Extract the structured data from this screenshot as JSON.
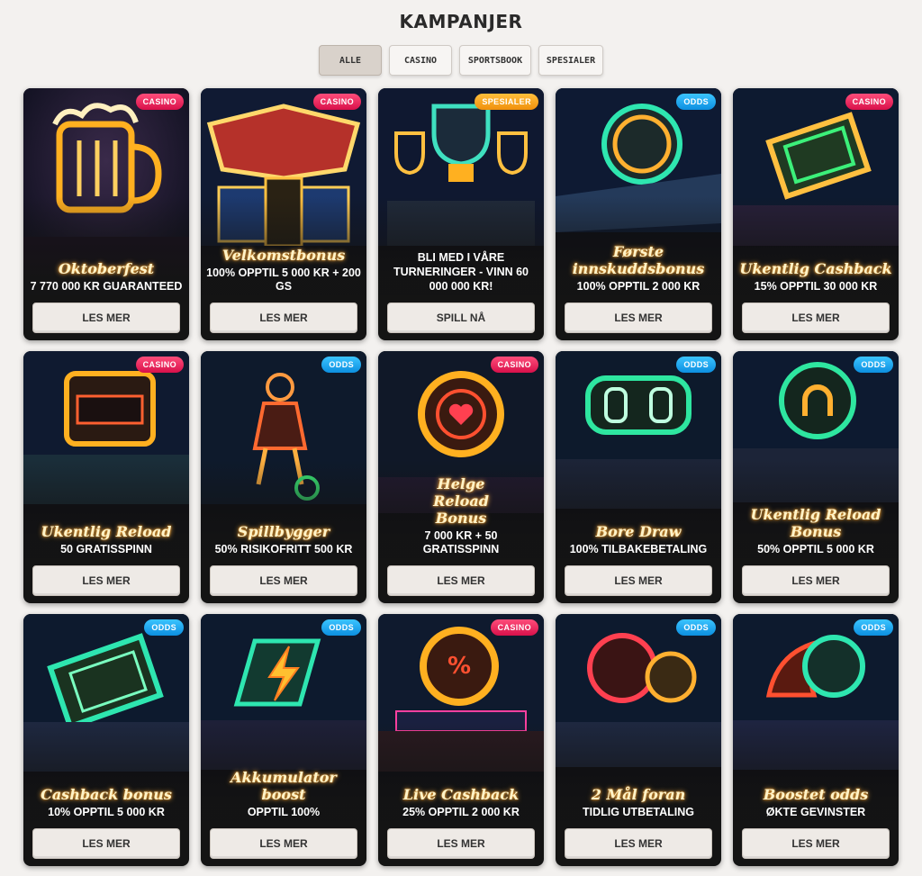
{
  "page": {
    "title": "KAMPANJER"
  },
  "filters": [
    {
      "label": "ALLE",
      "active": true
    },
    {
      "label": "CASINO",
      "active": false
    },
    {
      "label": "SPORTSBOOK",
      "active": false
    },
    {
      "label": "SPESIALER",
      "active": false
    }
  ],
  "colors": {
    "casino_badge": "#e8275c",
    "odds_badge": "#1ea8f0",
    "spesialer_badge": "#f7a51f",
    "neon_title": "#fff3c8"
  },
  "promotions": [
    {
      "badge": "CASINO",
      "title": "Oktoberfest",
      "subtitle": "7 770 000 KR GUARANTEED",
      "button": "LES MER",
      "icon": "beer-mug-icon"
    },
    {
      "badge": "CASINO",
      "title": "Velkomstbonus",
      "subtitle": "100% OPPTIL 5 000 KR + 200 GS",
      "button": "LES MER",
      "icon": "welcome-sign-icon"
    },
    {
      "badge": "SPESIALER",
      "title": "",
      "subtitle": "BLI MED I VÅRE TURNERINGER - VINN 60 000 000 KR!",
      "button": "SPILL NÅ",
      "icon": "trophy-icon"
    },
    {
      "badge": "ODDS",
      "title": "Første innskuddsbonus",
      "subtitle": "100% OPPTIL 2 000 KR",
      "button": "LES MER",
      "icon": "football-icon"
    },
    {
      "badge": "CASINO",
      "title": "Ukentlig Cashback",
      "subtitle": "15% OPPTIL 30 000 KR",
      "button": "LES MER",
      "icon": "cash-icon"
    },
    {
      "badge": "CASINO",
      "title": "Ukentlig Reload",
      "subtitle": "50 GRATISSPINN",
      "button": "LES MER",
      "icon": "slot-machine-icon"
    },
    {
      "badge": "ODDS",
      "title": "Spillbygger",
      "subtitle": "50% RISIKOFRITT 500 KR",
      "button": "LES MER",
      "icon": "player-icon"
    },
    {
      "badge": "CASINO",
      "title": "Helge Reload Bonus",
      "subtitle": "7 000 KR + 50 GRATISSPINN",
      "button": "LES MER",
      "icon": "heart-chip-icon"
    },
    {
      "badge": "ODDS",
      "title": "Bore Draw",
      "subtitle": "100% TILBAKEBETALING",
      "button": "LES MER",
      "icon": "scoreboard-icon"
    },
    {
      "badge": "ODDS",
      "title": "Ukentlig Reload Bonus",
      "subtitle": "50% OPPTIL 5 000 KR",
      "button": "LES MER",
      "icon": "horseshoe-icon"
    },
    {
      "badge": "ODDS",
      "title": "Cashback bonus",
      "subtitle": "10% OPPTIL 5 000 KR",
      "button": "LES MER",
      "icon": "cash-icon"
    },
    {
      "badge": "ODDS",
      "title": "Akkumulator boost",
      "subtitle": "OPPTIL 100%",
      "button": "LES MER",
      "icon": "lightning-icon"
    },
    {
      "badge": "CASINO",
      "title": "Live Cashback",
      "subtitle": "25% OPPTIL 2 000 KR",
      "button": "LES MER",
      "icon": "percent-wheel-icon"
    },
    {
      "badge": "ODDS",
      "title": "2 Mål foran",
      "subtitle": "TIDLIG UTBETALING",
      "button": "LES MER",
      "icon": "two-balls-icon"
    },
    {
      "badge": "ODDS",
      "title": "Boostet odds",
      "subtitle": "ØKTE GEVINSTER",
      "button": "LES MER",
      "icon": "flaming-ball-icon"
    }
  ]
}
